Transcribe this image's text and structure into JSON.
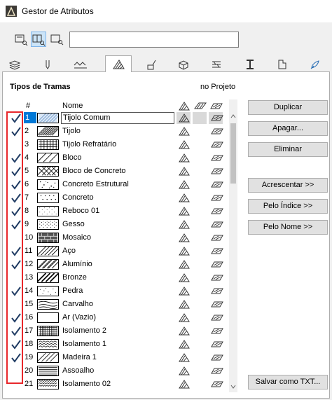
{
  "window": {
    "title": "Gestor de Atributos"
  },
  "search": {
    "value": "",
    "placeholder": ""
  },
  "view_buttons": [
    "list-view-icon",
    "details-view-icon",
    "search-view-icon"
  ],
  "tabs": [
    {
      "icon": "layers-icon"
    },
    {
      "icon": "pen-icon"
    },
    {
      "icon": "line-type-icon"
    },
    {
      "icon": "fill-type-icon",
      "active": true
    },
    {
      "icon": "surface-icon"
    },
    {
      "icon": "building-material-icon"
    },
    {
      "icon": "composite-icon"
    },
    {
      "icon": "profile-icon"
    },
    {
      "icon": "zone-icon"
    },
    {
      "icon": "mep-icon"
    }
  ],
  "section": {
    "title": "Tipos de Tramas",
    "project_label": "no Projeto"
  },
  "list": {
    "headers": {
      "number": "#",
      "name": "Nome"
    },
    "rows": [
      {
        "num": "1",
        "name": "Tijolo Comum",
        "checked": true,
        "pattern": "diag-light-blue",
        "selected": true
      },
      {
        "num": "2",
        "name": "Tijolo",
        "checked": true,
        "pattern": "diag-dense"
      },
      {
        "num": "3",
        "name": "Tijolo Refratário",
        "checked": false,
        "pattern": "grid"
      },
      {
        "num": "4",
        "name": "Bloco",
        "checked": true,
        "pattern": "diag-sparse"
      },
      {
        "num": "5",
        "name": "Bloco de Concreto",
        "checked": true,
        "pattern": "cross"
      },
      {
        "num": "6",
        "name": "Concreto Estrutural",
        "checked": true,
        "pattern": "dots-mixed"
      },
      {
        "num": "7",
        "name": "Concreto",
        "checked": true,
        "pattern": "dots"
      },
      {
        "num": "8",
        "name": "Reboco 01",
        "checked": true,
        "pattern": "dots-fine"
      },
      {
        "num": "9",
        "name": "Gesso",
        "checked": true,
        "pattern": "dots-dense"
      },
      {
        "num": "10",
        "name": "Mosaico",
        "checked": false,
        "pattern": "tiles"
      },
      {
        "num": "11",
        "name": "Aço",
        "checked": true,
        "pattern": "diag-medium"
      },
      {
        "num": "12",
        "name": "Alumínio",
        "checked": true,
        "pattern": "diag-double"
      },
      {
        "num": "13",
        "name": "Bronze",
        "checked": false,
        "pattern": "diag-thick"
      },
      {
        "num": "14",
        "name": "Pedra",
        "checked": true,
        "pattern": "stipple"
      },
      {
        "num": "15",
        "name": "Carvalho",
        "checked": false,
        "pattern": "wood"
      },
      {
        "num": "16",
        "name": "Ar (Vazio)",
        "checked": true,
        "pattern": "empty"
      },
      {
        "num": "17",
        "name": "Isolamento 2",
        "checked": true,
        "pattern": "grid-fine"
      },
      {
        "num": "18",
        "name": "Isolamento 1",
        "checked": true,
        "pattern": "zigzag"
      },
      {
        "num": "19",
        "name": "Madeira 1",
        "checked": true,
        "pattern": "diag-loose"
      },
      {
        "num": "20",
        "name": "Assoalho",
        "checked": false,
        "pattern": "horizontal"
      },
      {
        "num": "21",
        "name": "Isolamento 02",
        "checked": false,
        "pattern": "zigzag-dense"
      }
    ]
  },
  "buttons": {
    "duplicate": "Duplicar",
    "delete": "Apagar...",
    "remove": "Eliminar",
    "append": "Acrescentar >>",
    "by_index": "Pelo Índice >>",
    "by_name": "Pelo Nome >>",
    "save_txt": "Salvar como TXT..."
  },
  "colors": {
    "selection": "#0078d7",
    "highlight": "#e8272b",
    "check": "#1f3b63"
  }
}
